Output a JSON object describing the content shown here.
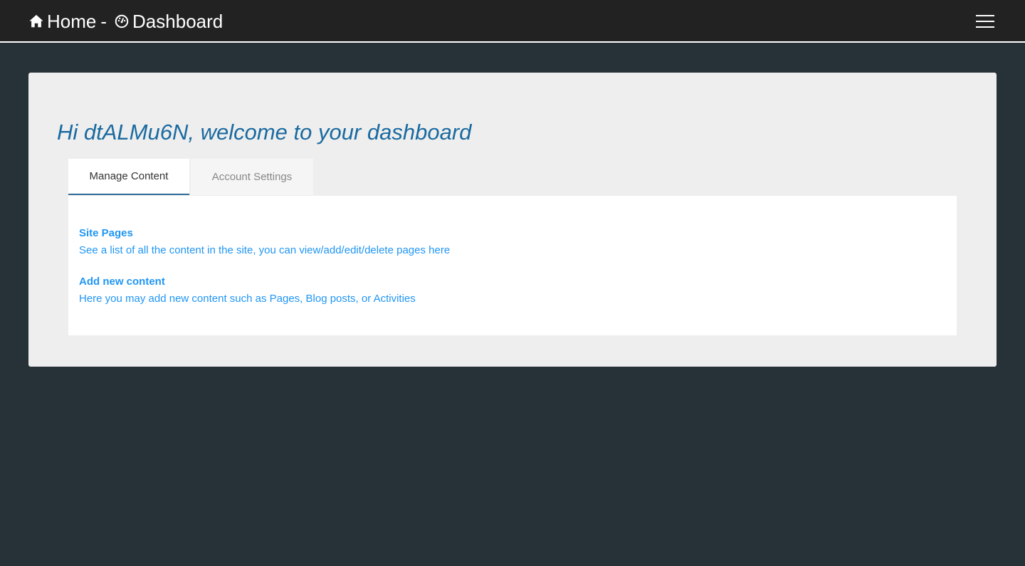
{
  "navbar": {
    "home_label": "Home",
    "separator": "-",
    "dashboard_label": "Dashboard"
  },
  "main": {
    "welcome": "Hi dtALMu6N, welcome to your dashboard",
    "tabs": [
      {
        "label": "Manage Content",
        "active": true
      },
      {
        "label": "Account Settings",
        "active": false
      }
    ],
    "items": [
      {
        "title": "Site Pages",
        "description": "See a list of all the content in the site, you can view/add/edit/delete pages here"
      },
      {
        "title": "Add new content",
        "description": "Here you may add new content such as Pages, Blog posts, or Activities"
      }
    ]
  },
  "colors": {
    "page_bg": "#263238",
    "navbar_bg": "#222222",
    "panel_bg": "#eeeeee",
    "welcome_text": "#1a6aa0",
    "link": "#2196f3"
  },
  "icons": {
    "home": "home-icon",
    "dashboard": "dashboard-gauge-icon",
    "menu": "hamburger-menu-icon"
  }
}
